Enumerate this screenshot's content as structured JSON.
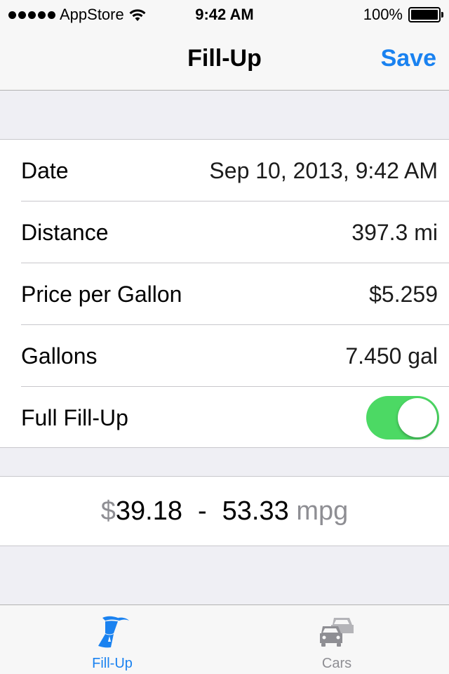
{
  "status_bar": {
    "carrier": "AppStore",
    "time": "9:42 AM",
    "battery": "100%",
    "signal_bars": 5
  },
  "nav": {
    "title": "Fill-Up",
    "save_label": "Save"
  },
  "form": {
    "rows": [
      {
        "label": "Date",
        "value": "Sep 10, 2013, 9:42 AM"
      },
      {
        "label": "Distance",
        "value": "397.3 mi"
      },
      {
        "label": "Price per Gallon",
        "value": "$5.259"
      },
      {
        "label": "Gallons",
        "value": "7.450 gal"
      }
    ],
    "full_fillup": {
      "label": "Full Fill-Up",
      "on": true
    }
  },
  "summary": {
    "currency_symbol": "$",
    "cost": "39.18",
    "separator": "-",
    "mpg_value": "53.33",
    "mpg_unit": "mpg"
  },
  "tabs": [
    {
      "label": "Fill-Up",
      "icon": "fuel-pump-icon",
      "selected": true
    },
    {
      "label": "Cars",
      "icon": "cars-icon",
      "selected": false
    }
  ],
  "colors": {
    "accent": "#1a82f0",
    "toggle_on": "#4cd964",
    "background": "#efeff4",
    "inactive": "#8e8e93"
  }
}
